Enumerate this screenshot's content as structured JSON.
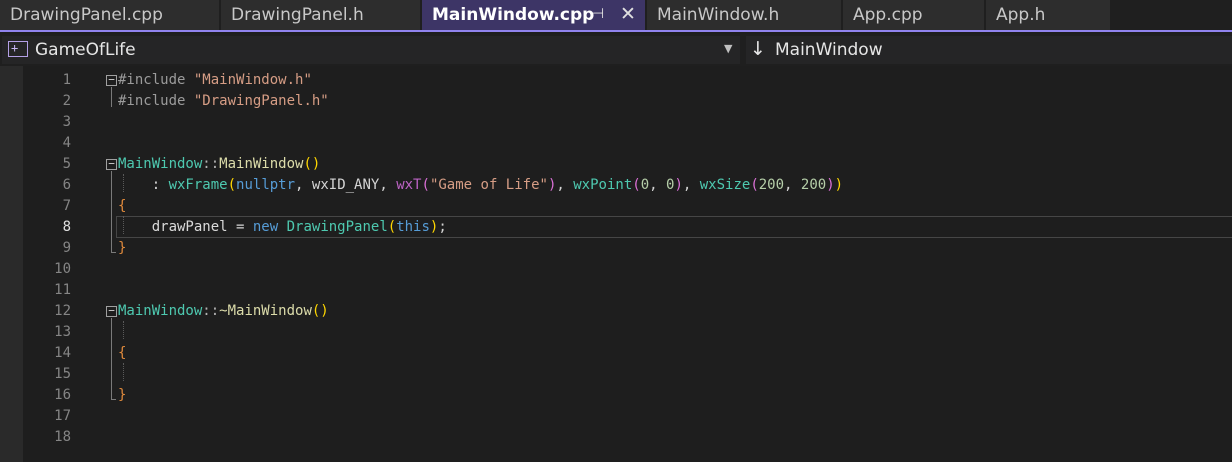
{
  "tabs": [
    {
      "label": "DrawingPanel.cpp",
      "active": false
    },
    {
      "label": "DrawingPanel.h",
      "active": false
    },
    {
      "label": "MainWindow.cpp",
      "active": true
    },
    {
      "label": "MainWindow.h",
      "active": false
    },
    {
      "label": "App.cpp",
      "active": false
    },
    {
      "label": "App.h",
      "active": false
    }
  ],
  "nav": {
    "project": "GameOfLife",
    "member": "MainWindow",
    "project_icon": "project-icon",
    "member_icon": "down-arrow-icon"
  },
  "editor": {
    "current_line": 8,
    "line_numbers": [
      "1",
      "2",
      "3",
      "4",
      "5",
      "6",
      "7",
      "8",
      "9",
      "10",
      "11",
      "12",
      "13",
      "14",
      "15",
      "16",
      "17",
      "18"
    ],
    "code": {
      "l1": {
        "directive": "#include",
        "file": "\"MainWindow.h\""
      },
      "l2": {
        "directive": "#include",
        "file": "\"DrawingPanel.h\""
      },
      "l5": {
        "cls": "MainWindow",
        "sep": "::",
        "fn": "MainWindow",
        "paren": "()"
      },
      "l6": {
        "colon": ": ",
        "base": "wxFrame",
        "open": "(",
        "arg1": "nullptr",
        "c1": ", ",
        "arg2": "wxID_ANY",
        "c2": ", ",
        "macro": "wxT",
        "mopen": "(",
        "title": "\"Game of Life\"",
        "mclose": ")",
        "c3": ", ",
        "point": "wxPoint",
        "popen": "(",
        "px": "0",
        "pc": ", ",
        "py": "0",
        "pclose": ")",
        "c4": ", ",
        "size": "wxSize",
        "sopen": "(",
        "sw": "200",
        "sc": ", ",
        "sh": "200",
        "sclose": ")",
        "close": ")"
      },
      "l7": {
        "brace": "{"
      },
      "l8": {
        "var": "drawPanel",
        "eq": " = ",
        "kw_new": "new",
        "sp": " ",
        "type": "DrawingPanel",
        "open": "(",
        "kw_this": "this",
        "close": ")",
        "semi": ";"
      },
      "l9": {
        "brace": "}"
      },
      "l12": {
        "cls": "MainWindow",
        "sep": "::",
        "fn": "~MainWindow",
        "paren": "()"
      },
      "l14": {
        "brace": "{"
      },
      "l16": {
        "brace": "}"
      }
    }
  },
  "colors": {
    "accent": "#9184ee",
    "active_tab": "#3d3566",
    "editor_bg": "#1e1e1e"
  }
}
